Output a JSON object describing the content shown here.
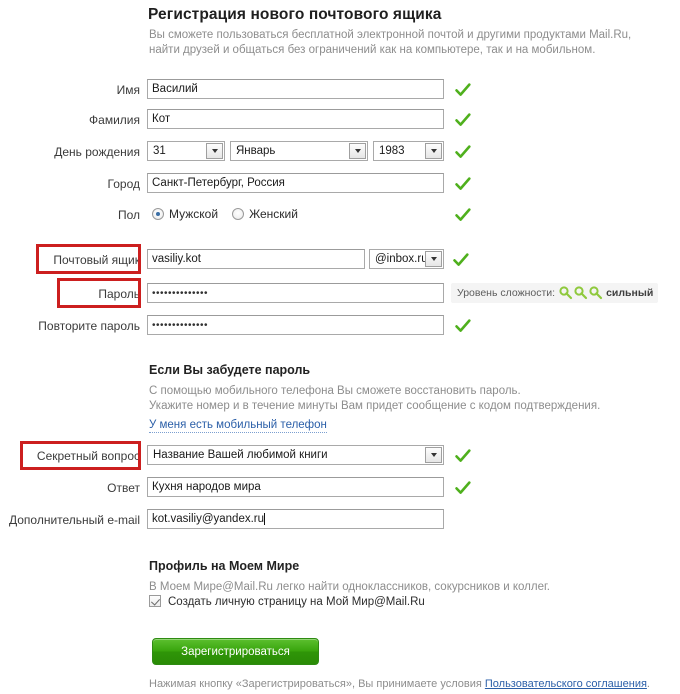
{
  "header": {
    "title": "Регистрация нового почтового ящика",
    "intro_line1": "Вы сможете пользоваться бесплатной электронной почтой и другими продуктами Mail.Ru,",
    "intro_line2": "найти друзей и общаться без ограничений как на компьютере, так и на мобильном."
  },
  "fields": {
    "first_name": {
      "label": "Имя",
      "value": "Василий",
      "valid": true
    },
    "last_name": {
      "label": "Фамилия",
      "value": "Кот",
      "valid": true
    },
    "birthday": {
      "label": "День рождения",
      "day": "31",
      "month": "Январь",
      "year": "1983",
      "valid": true
    },
    "city": {
      "label": "Город",
      "value": "Санкт-Петербург, Россия",
      "valid": true
    },
    "gender": {
      "label": "Пол",
      "male": "Мужской",
      "female": "Женский",
      "selected": "male",
      "valid": true
    },
    "mailbox": {
      "label": "Почтовый ящик",
      "value": "vasiliy.kot",
      "domain": "@inbox.ru",
      "valid": true,
      "highlighted": true
    },
    "password": {
      "label": "Пароль",
      "value": "••••••••••••••",
      "highlighted": true
    },
    "password_repeat": {
      "label": "Повторите пароль",
      "value": "••••••••••••••",
      "valid": true
    },
    "secret_question": {
      "label": "Секретный вопрос",
      "value": "Название Вашей любимой книги",
      "valid": true,
      "highlighted": true
    },
    "answer": {
      "label": "Ответ",
      "value": "Кухня народов мира",
      "valid": true
    },
    "extra_email": {
      "label": "Дополнительный e-mail",
      "value": "kot.vasiliy@yandex.ru",
      "valid": false
    }
  },
  "strength": {
    "label": "Уровень сложности:",
    "word": "сильный",
    "keys": 3,
    "key_color": "#8fc93d"
  },
  "forgot_section": {
    "title": "Если Вы забудете пароль",
    "line1": "С помощью мобильного телефона Вы сможете восстановить пароль.",
    "line2": "Укажите номер и в течение минуты Вам придет сообщение с кодом подтверждения.",
    "link": "У меня есть мобильный телефон"
  },
  "profile_section": {
    "title": "Профиль на Моем Мире",
    "line1": "В Моем Мире@Mail.Ru легко найти одноклассников, сокурсников и коллег.",
    "checkbox_label": "Создать личную страницу на Мой Мир@Mail.Ru",
    "checkbox_checked": true
  },
  "footer": {
    "submit_label": "Зарегистрироваться",
    "terms_prefix": "Нажимая кнопку «Зарегистрироваться», Вы принимаете условия ",
    "terms_link": "Пользовательского соглашения",
    "terms_suffix": "."
  },
  "icons": {
    "check": "green-check-icon",
    "dropdown": "chevron-down-icon",
    "key": "key-icon"
  },
  "colors": {
    "accent_green": "#4fb01d",
    "highlight_red": "#cc1f1f",
    "link_blue": "#2b5fa8",
    "muted_text": "#8d8d8d"
  }
}
